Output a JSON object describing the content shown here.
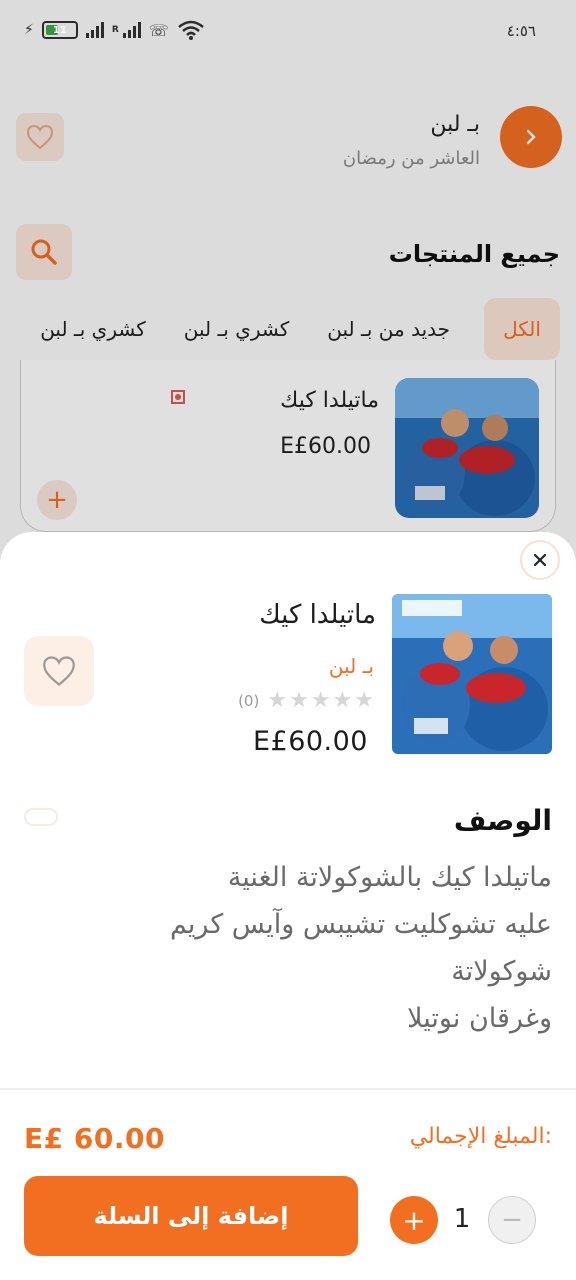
{
  "status_bar": {
    "time": "٤:٥٦",
    "battery": "11"
  },
  "header": {
    "store_name": "بـ لبن",
    "store_location": "العاشر من رمضان"
  },
  "listing": {
    "section_title": "جميع المنتجات",
    "tabs": [
      "الكل",
      "جديد من بـ لبن",
      "كشري بـ لبن",
      "كشري بـ لبن"
    ],
    "active_tab": 0,
    "product": {
      "name": "ماتيلدا كيك",
      "price": "E£60.00",
      "add": "+"
    }
  },
  "sheet": {
    "close": "×",
    "title": "ماتيلدا كيك",
    "store": "بـ لبن",
    "rating": {
      "stars": 0,
      "max": 5,
      "count": "(0)"
    },
    "price": "E£60.00",
    "description_heading": "الوصف",
    "description": "ماتيلدا كيك بالشوكولاتة الغنية\nعليه تشوكليت تشيبس وآيس كريم\nشوكولاتة\nوغرقان نوتيلا",
    "total_label": "المبلغ الإجمالي:",
    "total_value": "E£ 60.00",
    "add_to_cart": "إضافة إلى السلة",
    "quantity": "1",
    "plus": "+",
    "minus": "−"
  },
  "colors": {
    "accent": "#f26f21",
    "accent_light": "#fbe4d7"
  }
}
